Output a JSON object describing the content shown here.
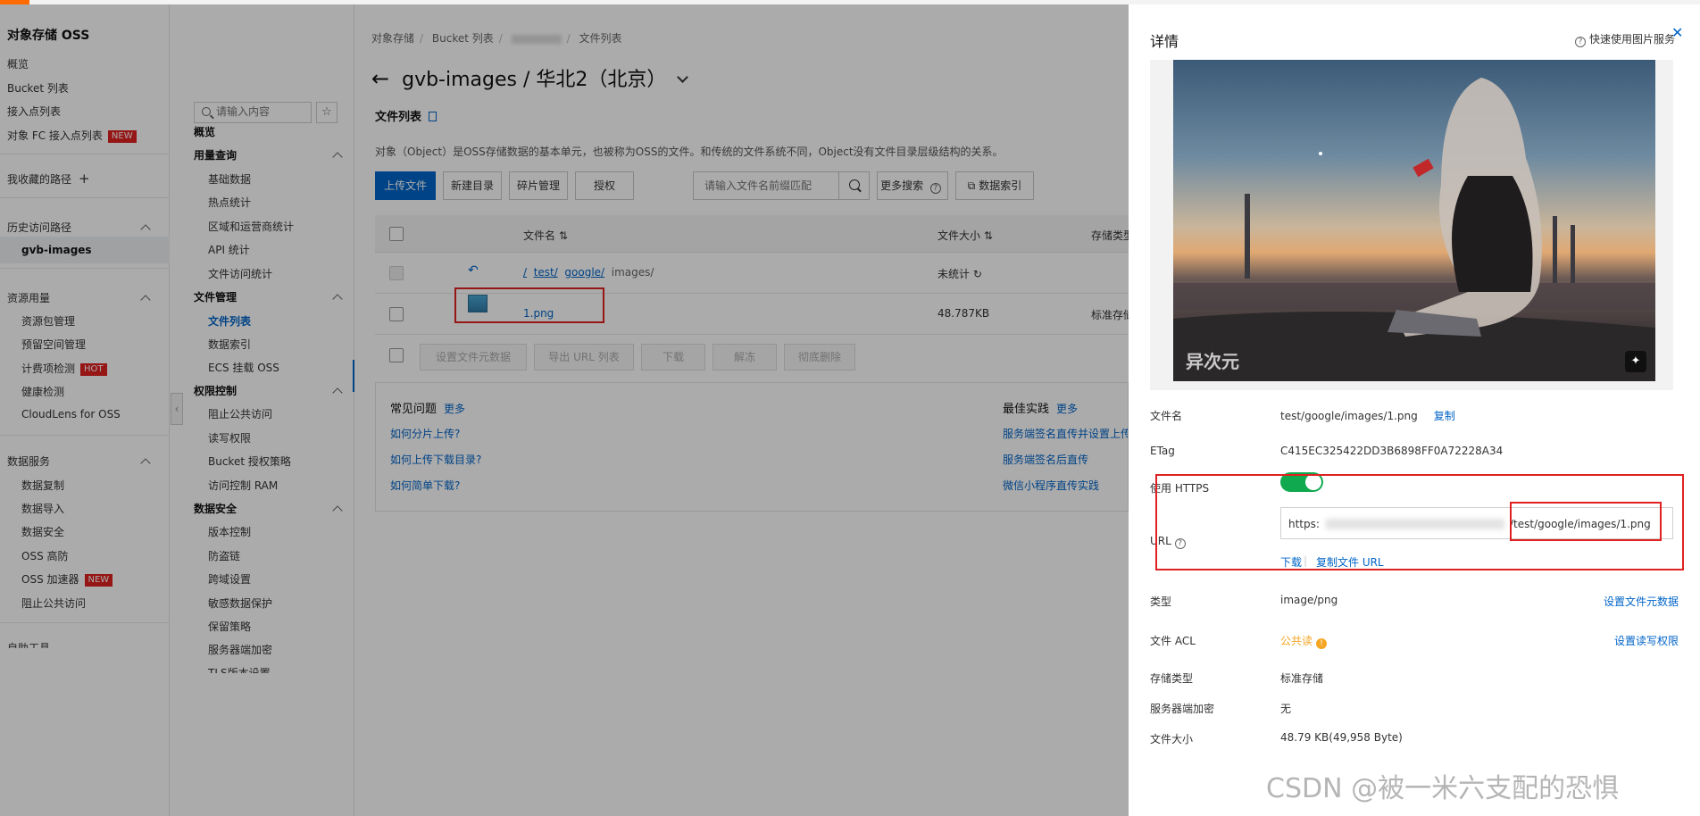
{
  "nav": {
    "title": "对象存储 OSS",
    "items": [
      "概览",
      "Bucket 列表",
      "接入点列表",
      "对象 FC 接入点列表"
    ],
    "new_badge": "NEW",
    "hot_badge": "HOT",
    "favorites": "我收藏的路径",
    "history": "历史访问路径",
    "history_item": "gvb-images",
    "resource_group": "资源用量",
    "resource_items": [
      "资源包管理",
      "预留空间管理",
      "计费项检测",
      "健康检测",
      "CloudLens for OSS"
    ],
    "data_group": "数据服务",
    "data_items": [
      "数据复制",
      "数据导入",
      "数据安全",
      "OSS 高防",
      "OSS 加速器",
      "阻止公共访问"
    ],
    "more_group": "自助工具"
  },
  "bucket_nav": {
    "search_placeholder": "请输入内容",
    "overview": "概览",
    "usage_group": "用量查询",
    "usage_items": [
      "基础数据",
      "热点统计",
      "区域和运营商统计",
      "API 统计",
      "文件访问统计"
    ],
    "file_group": "文件管理",
    "file_items": [
      "文件列表",
      "数据索引",
      "ECS 挂载 OSS"
    ],
    "perm_group": "权限控制",
    "perm_items": [
      "阻止公共访问",
      "读写权限",
      "Bucket 授权策略",
      "访问控制 RAM"
    ],
    "sec_group": "数据安全",
    "sec_items": [
      "版本控制",
      "防盗链",
      "跨域设置",
      "敏感数据保护",
      "保留策略",
      "服务器端加密",
      "TLS版本设置"
    ]
  },
  "main": {
    "breadcrumb": [
      "对象存储",
      "Bucket 列表",
      "文件列表"
    ],
    "title": "gvb-images / 华北2（北京）",
    "section_title": "文件列表",
    "description": "对象（Object）是OSS存储数据的基本单元，也被称为OSS的文件。和传统的文件系统不同，Object没有文件目录层级结构的关系。",
    "buttons": [
      "上传文件",
      "新建目录",
      "碎片管理",
      "授权"
    ],
    "file_search_placeholder": "请输入文件名前缀匹配",
    "more_search": "更多搜索",
    "data_index": "数据索引",
    "columns": [
      "文件名",
      "文件大小",
      "存储类型"
    ],
    "path_row": {
      "root": "/",
      "p1": "test/",
      "p2": "google/",
      "p3": "images/",
      "size": "未统计"
    },
    "file_row": {
      "name": "1.png",
      "size": "48.787KB",
      "storage": "标准存储"
    },
    "bulk_actions": [
      "设置文件元数据",
      "导出 URL 列表",
      "下载",
      "解冻",
      "彻底删除"
    ],
    "faq": {
      "title": "常见问题",
      "more": "更多",
      "links": [
        "如何分片上传?",
        "如何上传下载目录?",
        "如何简单下载?"
      ],
      "best_title": "最佳实践",
      "best_links": [
        "服务端签名直传并设置上传",
        "服务端签名后直传",
        "微信小程序直传实践"
      ]
    }
  },
  "drawer": {
    "title": "详情",
    "quick_service": "快速使用图片服务",
    "watermark": "异次元",
    "labels": {
      "filename": "文件名",
      "etag": "ETag",
      "https": "使用 HTTPS",
      "url": "URL",
      "type": "类型",
      "acl": "文件 ACL",
      "storage": "存储类型",
      "encryption": "服务器端加密",
      "size": "文件大小"
    },
    "values": {
      "filename": "test/google/images/1.png",
      "copy": "复制",
      "etag": "C415EC325422DD3B6898FF0A72228A34",
      "url_prefix": "https:",
      "url_suffix": "/test/google/images/1.png",
      "download": "下载",
      "copy_url": "复制文件 URL",
      "type": "image/png",
      "set_meta": "设置文件元数据",
      "acl": "公共读",
      "set_acl": "设置读写权限",
      "storage": "标准存储",
      "encryption": "无",
      "size": "48.79 KB(49,958 Byte)"
    },
    "https_on": true
  },
  "watermark_text": "CSDN @被一米六支配的恐惧"
}
